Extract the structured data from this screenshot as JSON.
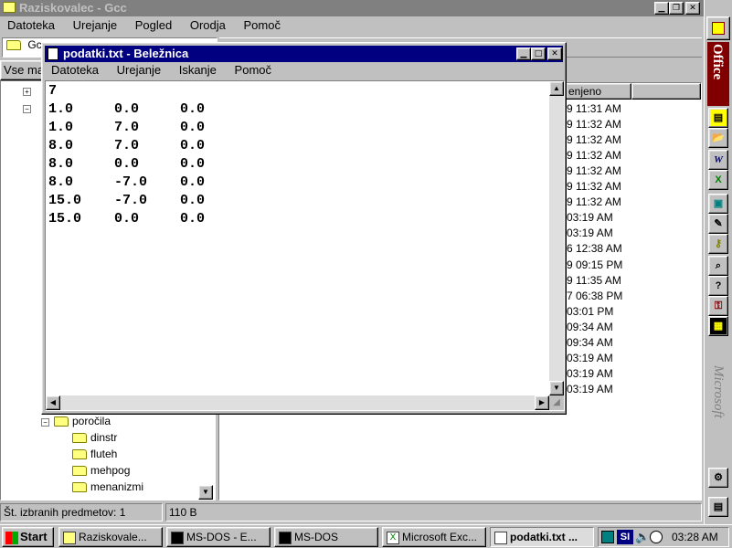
{
  "explorer": {
    "title": "Raziskovalec - Gcc",
    "menu": [
      "Datoteka",
      "Urejanje",
      "Pogled",
      "Orodja",
      "Pomoč"
    ],
    "address_value": "Gcc",
    "tree_header": "Vse ma",
    "list_header_modified": "enjeno",
    "tree_items": [
      {
        "label": "poročila",
        "expander": "⊟"
      },
      {
        "label": "dinstr"
      },
      {
        "label": "fluteh"
      },
      {
        "label": "mehpog"
      },
      {
        "label": "menanizmi"
      }
    ],
    "modified_times": [
      "9 11:31 AM",
      "9 11:32 AM",
      "9 11:32 AM",
      "9 11:32 AM",
      "9 11:32 AM",
      "9 11:32 AM",
      "9 11:32 AM",
      "03:19 AM",
      "03:19 AM",
      "6 12:38 AM",
      "9 09:15 PM",
      "9 11:35 AM",
      "7 06:38 PM",
      "03:01 PM",
      "09:34 AM",
      "09:34 AM",
      "03:19 AM",
      "03:19 AM",
      "03:19 AM"
    ],
    "status_left": "Št. izbranih predmetov: 1",
    "status_right": "110 B"
  },
  "notepad": {
    "title": "podatki.txt - Beležnica",
    "menu": [
      "Datoteka",
      "Urejanje",
      "Iskanje",
      "Pomoč"
    ],
    "lines": [
      "7",
      "1.0     0.0     0.0",
      "1.0     7.0     0.0",
      "8.0     7.0     0.0",
      "8.0     0.0     0.0",
      "8.0     -7.0    0.0",
      "15.0    -7.0    0.0",
      "15.0    0.0     0.0"
    ]
  },
  "office_bar": {
    "label": "Office",
    "vendor": "Microsoft"
  },
  "taskbar": {
    "start": "Start",
    "tasks": [
      "Raziskovale...",
      "MS-DOS - E...",
      "MS-DOS",
      "Microsoft Exc...",
      "podatki.txt ..."
    ],
    "lang": "SI",
    "clock": "03:28 AM"
  },
  "colors": {
    "title_active": "#000080",
    "title_inactive": "#808080",
    "desktop": "#c0c0c0",
    "office_red": "#800000"
  }
}
